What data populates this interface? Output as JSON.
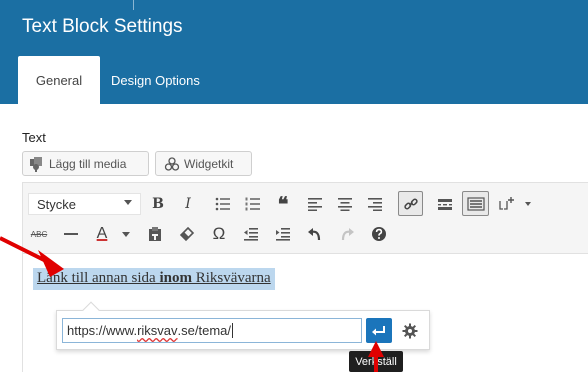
{
  "header": {
    "title": "Text Block Settings",
    "tabs": [
      {
        "label": "General",
        "active": true
      },
      {
        "label": "Design Options",
        "active": false
      }
    ],
    "bg_color": "#1b6fa3"
  },
  "field": {
    "label": "Text"
  },
  "media_buttons": {
    "add_media_label": "Lägg till media",
    "widgetkit_label": "Widgetkit"
  },
  "toolbar": {
    "format_select_value": "Stycke",
    "row1_icons": [
      "bold-icon",
      "italic-icon",
      "bullet-list-icon",
      "numbered-list-icon",
      "blockquote-icon",
      "align-left-icon",
      "align-center-icon",
      "align-right-icon",
      "link-icon",
      "read-more-icon",
      "keyboard-icon",
      "columns-add-icon"
    ],
    "row2_icons": [
      "strikethrough-icon",
      "horizontal-line-icon",
      "text-color-icon",
      "paste-text-icon",
      "clear-formatting-icon",
      "special-character-icon",
      "outdent-icon",
      "indent-icon",
      "undo-icon",
      "redo-icon",
      "help-icon"
    ],
    "bold_label": "B",
    "italic_label": "I",
    "strike_label": "ABC",
    "text_color_label": "A",
    "omega_label": "Ω",
    "quote_label": "❝"
  },
  "editor": {
    "link_text_before": "Länk till annan sida ",
    "link_text_bold": "inom",
    "link_text_after": " Riksvävarna"
  },
  "link_popup": {
    "url_prefix": "https://www.",
    "url_host": "riksvav",
    "url_suffix": ".se/tema/",
    "apply_tooltip": "Verkställ"
  },
  "colors": {
    "accent": "#1b75bb",
    "annotation_arrow": "#e00000",
    "selection": "#bcd7ee"
  }
}
